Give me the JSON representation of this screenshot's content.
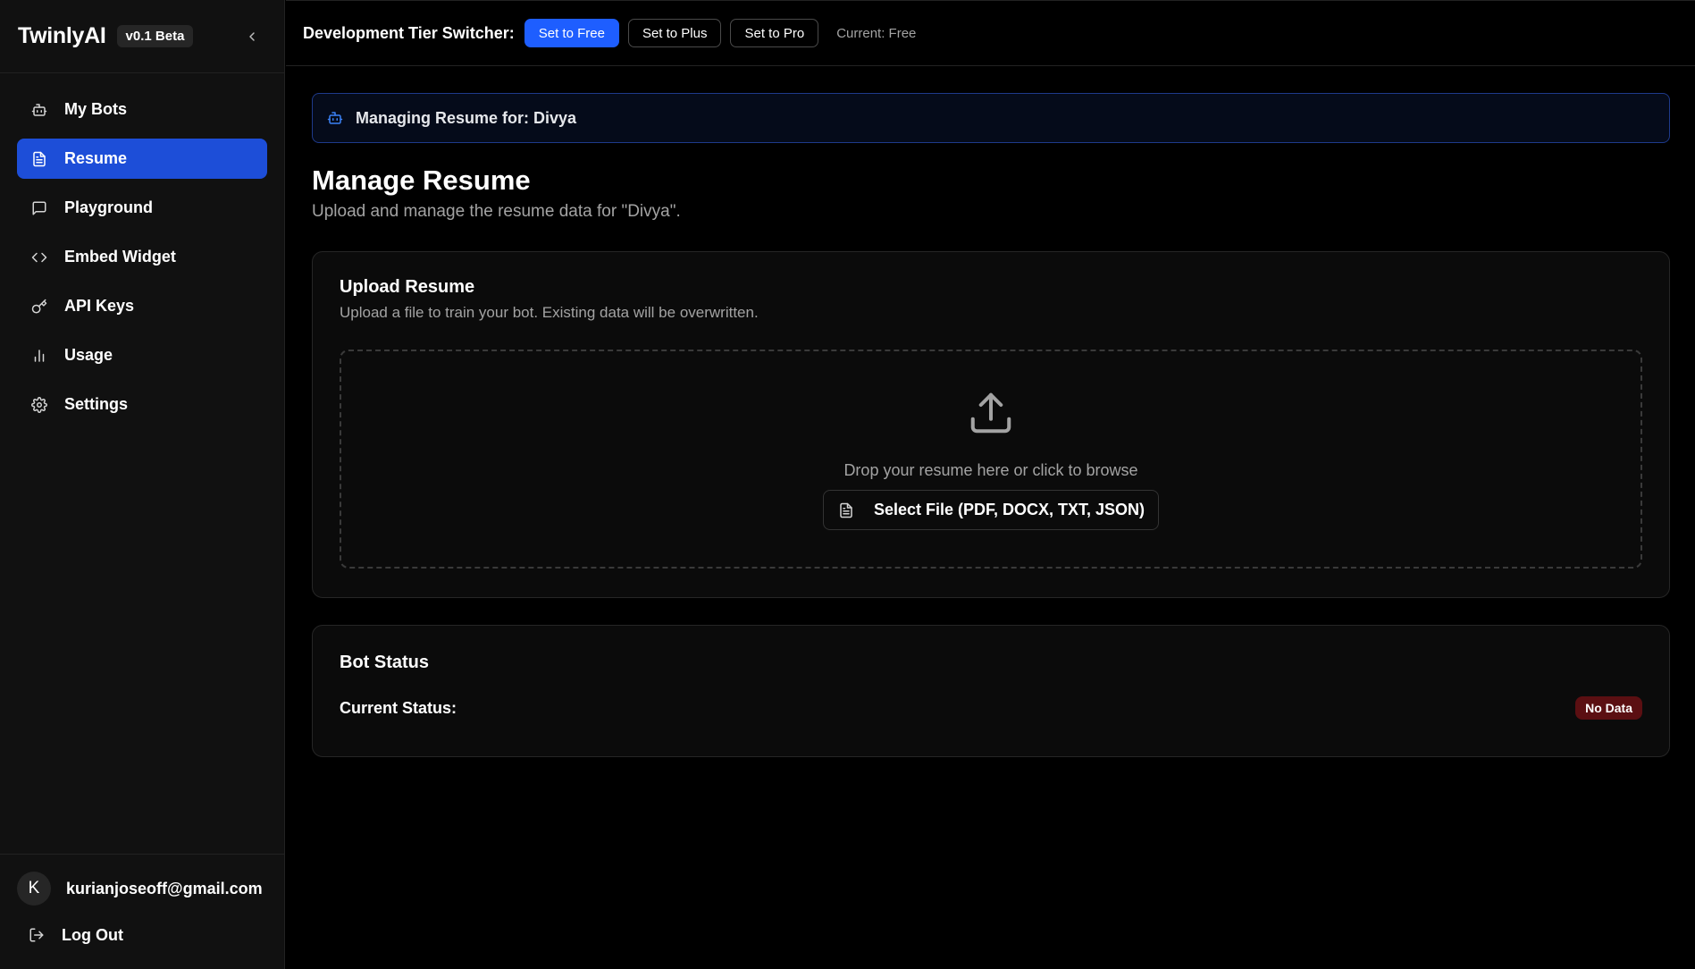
{
  "sidebar": {
    "brand": "TwinlyAI",
    "badge": "v0.1 Beta",
    "collapse_icon": "chevron-left-icon",
    "items": [
      {
        "label": "My Bots",
        "icon": "bot-icon"
      },
      {
        "label": "Resume",
        "icon": "file-text-icon",
        "active": true
      },
      {
        "label": "Playground",
        "icon": "message-square-icon"
      },
      {
        "label": "Embed Widget",
        "icon": "code-icon"
      },
      {
        "label": "API Keys",
        "icon": "key-icon"
      },
      {
        "label": "Usage",
        "icon": "bar-chart-icon"
      },
      {
        "label": "Settings",
        "icon": "gear-icon"
      }
    ],
    "user": {
      "initial": "K",
      "email": "kurianjoseoff@gmail.com"
    },
    "logout_label": "Log Out"
  },
  "topbar": {
    "label": "Development Tier Switcher:",
    "buttons": [
      "Set to Free",
      "Set to Plus",
      "Set to Pro"
    ],
    "current": "Current: Free"
  },
  "main": {
    "banner": "Managing Resume for: Divya",
    "title": "Manage Resume",
    "subtitle": "Upload and manage the resume data for \"Divya\".",
    "upload": {
      "title": "Upload Resume",
      "subtitle": "Upload a file to train your bot. Existing data will be overwritten.",
      "drop_text": "Drop your resume here or click to browse",
      "select_label": "Select File (PDF, DOCX, TXT, JSON)"
    },
    "status": {
      "title": "Bot Status",
      "label": "Current Status:",
      "badge": "No Data"
    }
  },
  "colors": {
    "accent": "#1e5eff",
    "active_nav": "#1d4ed8",
    "badge_no_data": "#5b0f12"
  }
}
